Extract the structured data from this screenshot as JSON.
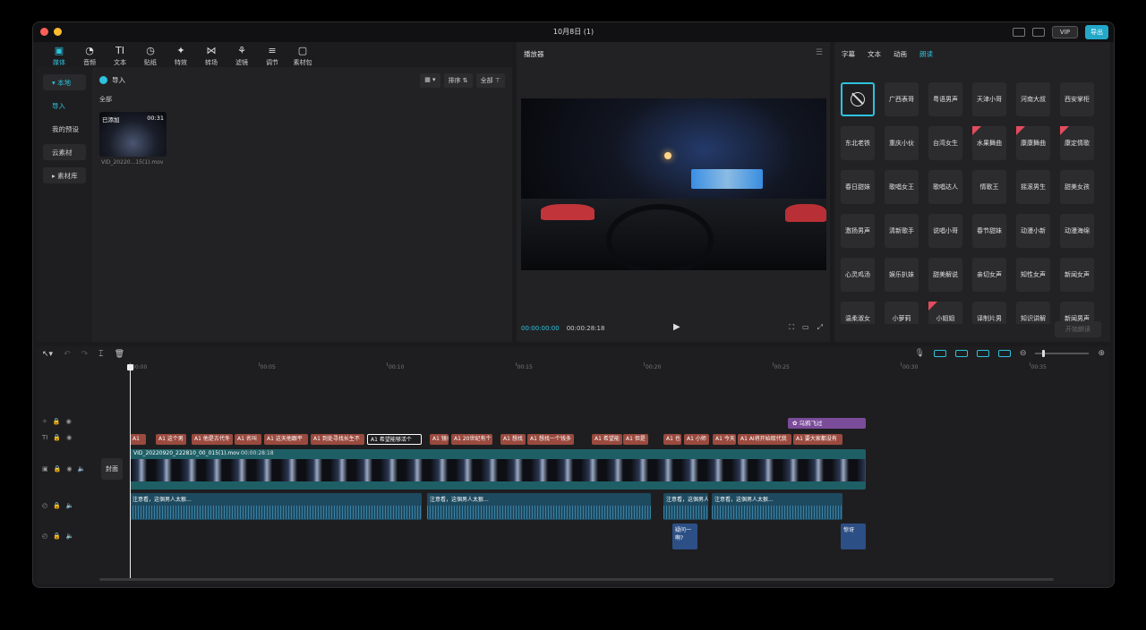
{
  "window": {
    "title": "10月8日 (1)",
    "vip_label": "VIP",
    "export_label": "导出"
  },
  "media_tools": [
    {
      "label": "媒体",
      "icon": "▣"
    },
    {
      "label": "音频",
      "icon": "◔"
    },
    {
      "label": "文本",
      "icon": "TI"
    },
    {
      "label": "贴纸",
      "icon": "◷"
    },
    {
      "label": "特效",
      "icon": "✦"
    },
    {
      "label": "转场",
      "icon": "⋈"
    },
    {
      "label": "滤镜",
      "icon": "⚘"
    },
    {
      "label": "调节",
      "icon": "≡"
    },
    {
      "label": "素材包",
      "icon": "▢"
    }
  ],
  "sidenav": {
    "local": "本地",
    "import": "导入",
    "presets": "我的预设",
    "cloud": "云素材",
    "library": "素材库"
  },
  "media": {
    "import_label": "导入",
    "filter_all": "全部",
    "sort_label": "排序",
    "all_label": "全部",
    "clip": {
      "added": "已添加",
      "duration": "00:31",
      "name": "VID_20220...15(1).mov"
    }
  },
  "player": {
    "title": "播放器",
    "current": "00:00:00:00",
    "total": "00:00:28:18"
  },
  "voice": {
    "tabs": [
      "字幕",
      "文本",
      "动画",
      "朗读"
    ],
    "start_label": "开始朗读",
    "voices": [
      "广西表哥",
      "粤语男声",
      "天津小哥",
      "河南大叔",
      "西安掌柜",
      "东北老铁",
      "重庆小伙",
      "台湾女生",
      "水果舞曲",
      "康康舞曲",
      "康定情歌",
      "春日甜妹",
      "歌唱女王",
      "歌唱达人",
      "情歌王",
      "摇滚男生",
      "甜美女孩",
      "激扬男声",
      "清新歌手",
      "说唱小哥",
      "春节甜妹",
      "动漫小新",
      "动漫海绵",
      "心灵鸡汤",
      "娱乐扒妹",
      "甜美解说",
      "亲切女声",
      "知性女声",
      "新闻女声",
      "温柔淑女",
      "小萝莉",
      "小姐姐",
      "译制片男",
      "知识讲解",
      "新闻男声"
    ]
  },
  "timeline": {
    "ruler": [
      "00:00",
      "00:05",
      "00:10",
      "00:15",
      "00:20",
      "00:25",
      "00:30",
      "00:35"
    ],
    "cover_label": "封面",
    "sticker_clip": "乌鸦飞过",
    "text_clips": [
      "A1 ",
      "A1 这个男",
      "A1 他是古代冬",
      "A1 名叫",
      "A1 这天他跟平",
      "A1 到处寻找长生不",
      "A1 希望能够活个",
      "A1 镜!",
      "A1 20世纪有个",
      "A1 想找",
      "A1 想找一个钱多",
      "A1 希望能",
      "A1 但是",
      "A1 也",
      "A1 小师",
      "A1 今天",
      "A1 AI将开始取代我",
      "A1 要大家都没有"
    ],
    "video_clip": {
      "name": "VID_20220920_222810_00_015(1).mov",
      "duration": "00:00:28:18"
    },
    "audio_label": "注意看，这個男人太狠...",
    "sfx_clips": [
      "疑问一啊?",
      "惊讶"
    ]
  },
  "colors": {
    "accent": "#2ec2de",
    "text_clip": "#9a4a3e",
    "sticker": "#7b4c9a",
    "video_track": "#1e5f66"
  }
}
